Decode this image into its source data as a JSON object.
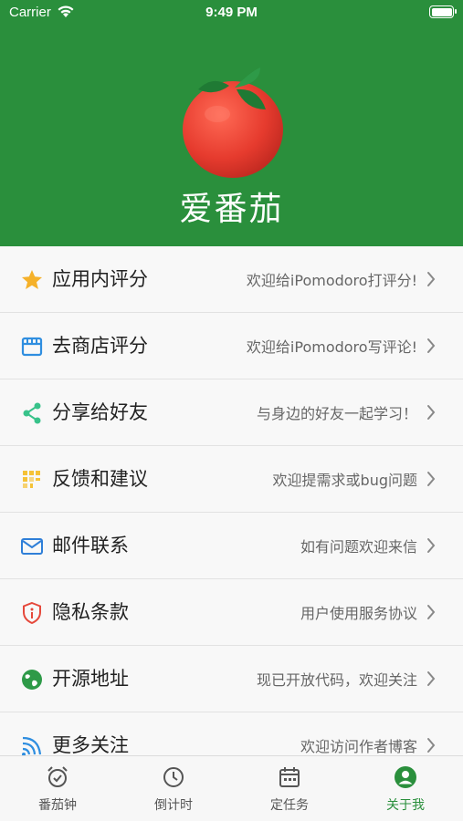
{
  "status_bar": {
    "carrier": "Carrier",
    "time": "9:49 PM"
  },
  "header": {
    "title": "爱番茄",
    "background_color": "#2a8f3c"
  },
  "menu": [
    {
      "label": "应用内评分",
      "desc": "欢迎给iPomodoro打评分!",
      "icon": "star-icon"
    },
    {
      "label": "去商店评分",
      "desc": "欢迎给iPomodoro写评论!",
      "icon": "store-icon"
    },
    {
      "label": "分享给好友",
      "desc": "与身边的好友一起学习！",
      "icon": "share-icon"
    },
    {
      "label": "反馈和建议",
      "desc": "欢迎提需求或bug问题",
      "icon": "feedback-icon"
    },
    {
      "label": "邮件联系",
      "desc": "如有问题欢迎来信",
      "icon": "mail-icon"
    },
    {
      "label": "隐私条款",
      "desc": "用户使用服务协议",
      "icon": "privacy-shield-icon"
    },
    {
      "label": "开源地址",
      "desc": "现已开放代码，欢迎关注",
      "icon": "globe-icon"
    },
    {
      "label": "更多关注",
      "desc": "欢迎访问作者博客",
      "icon": "rss-icon"
    }
  ],
  "tabs": [
    {
      "label": "番茄钟",
      "icon": "alarm-clock-icon",
      "active": false
    },
    {
      "label": "倒计时",
      "icon": "clock-icon",
      "active": false
    },
    {
      "label": "定任务",
      "icon": "calendar-icon",
      "active": false
    },
    {
      "label": "关于我",
      "icon": "user-circle-icon",
      "active": true
    }
  ],
  "colors": {
    "accent": "#2a8f3c",
    "star": "#f5b12a",
    "store": "#2f8ee0",
    "share": "#38c28a",
    "feedback": "#f5c236",
    "mail": "#2f7fd8",
    "privacy": "#e5483b",
    "globe": "#2e9a48",
    "rss": "#2f8ee0"
  }
}
